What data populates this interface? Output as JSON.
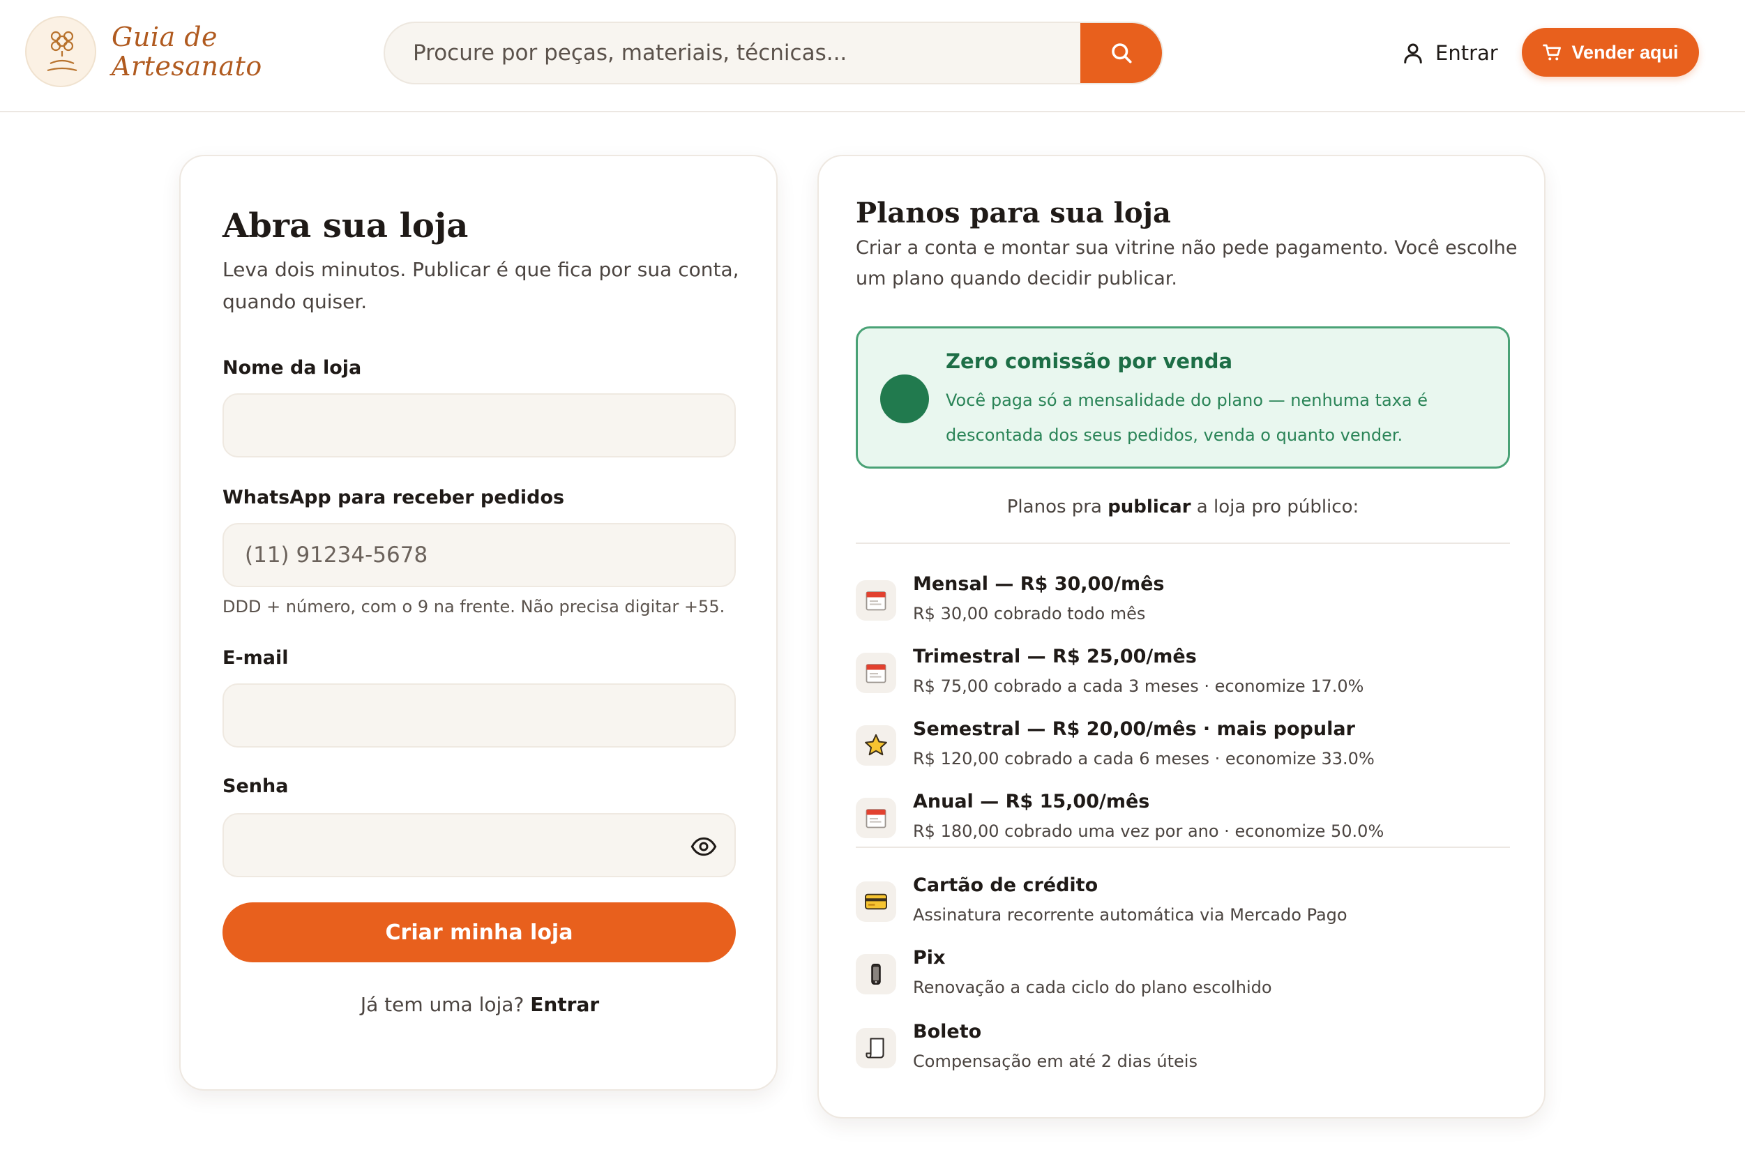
{
  "header": {
    "logo_line1": "Guia de",
    "logo_line2": "Artesanato",
    "search_placeholder": "Procure por peças, materiais, técnicas...",
    "login_label": "Entrar",
    "sell_label": "Vender aqui"
  },
  "signup": {
    "title": "Abra sua loja",
    "subtitle_line1": "Leva dois minutos. Publicar é que fica por sua conta,",
    "subtitle_line2": "quando quiser.",
    "store_name_label": "Nome da loja",
    "store_name_value": "",
    "whatsapp_label": "WhatsApp para receber pedidos",
    "whatsapp_placeholder": "(11) 91234-5678",
    "whatsapp_hint": "DDD + número, com o 9 na frente. Não precisa digitar +55.",
    "email_label": "E-mail",
    "email_value": "",
    "password_label": "Senha",
    "password_value": "",
    "submit_label": "Criar minha loja",
    "have_store_text": "Já tem uma loja?",
    "have_store_link": "Entrar"
  },
  "plans": {
    "title": "Planos para sua loja",
    "subtitle_line1": "Criar a conta e montar sua vitrine não pede pagamento. Você escolhe",
    "subtitle_line2": "um plano quando decidir publicar.",
    "promo": {
      "title": "Zero comissão por venda",
      "text_line1": "Você paga só a mensalidade do plano — nenhuma taxa é",
      "text_line2": "descontada dos seus pedidos, venda o quanto vender."
    },
    "caption_pre": "Planos pra",
    "caption_bold": "publicar",
    "caption_post": "a loja pro público:",
    "items": [
      {
        "icon": "calendar-icon",
        "title": "Mensal — R$ 30,00/mês",
        "desc": "R$ 30,00 cobrado todo mês"
      },
      {
        "icon": "calendar-icon",
        "title": "Trimestral — R$ 25,00/mês",
        "desc": "R$ 75,00 cobrado a cada 3 meses · economize 17.0%"
      },
      {
        "icon": "star-icon",
        "title": "Semestral — R$ 20,00/mês · mais popular",
        "desc": "R$ 120,00 cobrado a cada 6 meses · economize 33.0%"
      },
      {
        "icon": "calendar-icon",
        "title": "Anual — R$ 15,00/mês",
        "desc": "R$ 180,00 cobrado uma vez por ano · economize 50.0%"
      }
    ],
    "payments": [
      {
        "icon": "credit-card-icon",
        "title": "Cartão de crédito",
        "desc": "Assinatura recorrente automática via Mercado Pago"
      },
      {
        "icon": "phone-icon",
        "title": "Pix",
        "desc": "Renovação a cada ciclo do plano escolhido"
      },
      {
        "icon": "receipt-icon",
        "title": "Boleto",
        "desc": "Compensação em até 2 dias úteis"
      }
    ]
  },
  "colors": {
    "accent": "#e8601d",
    "promo_bg": "#e9f7ef",
    "promo_border": "#4aa276",
    "promo_text": "#1d6e46"
  }
}
